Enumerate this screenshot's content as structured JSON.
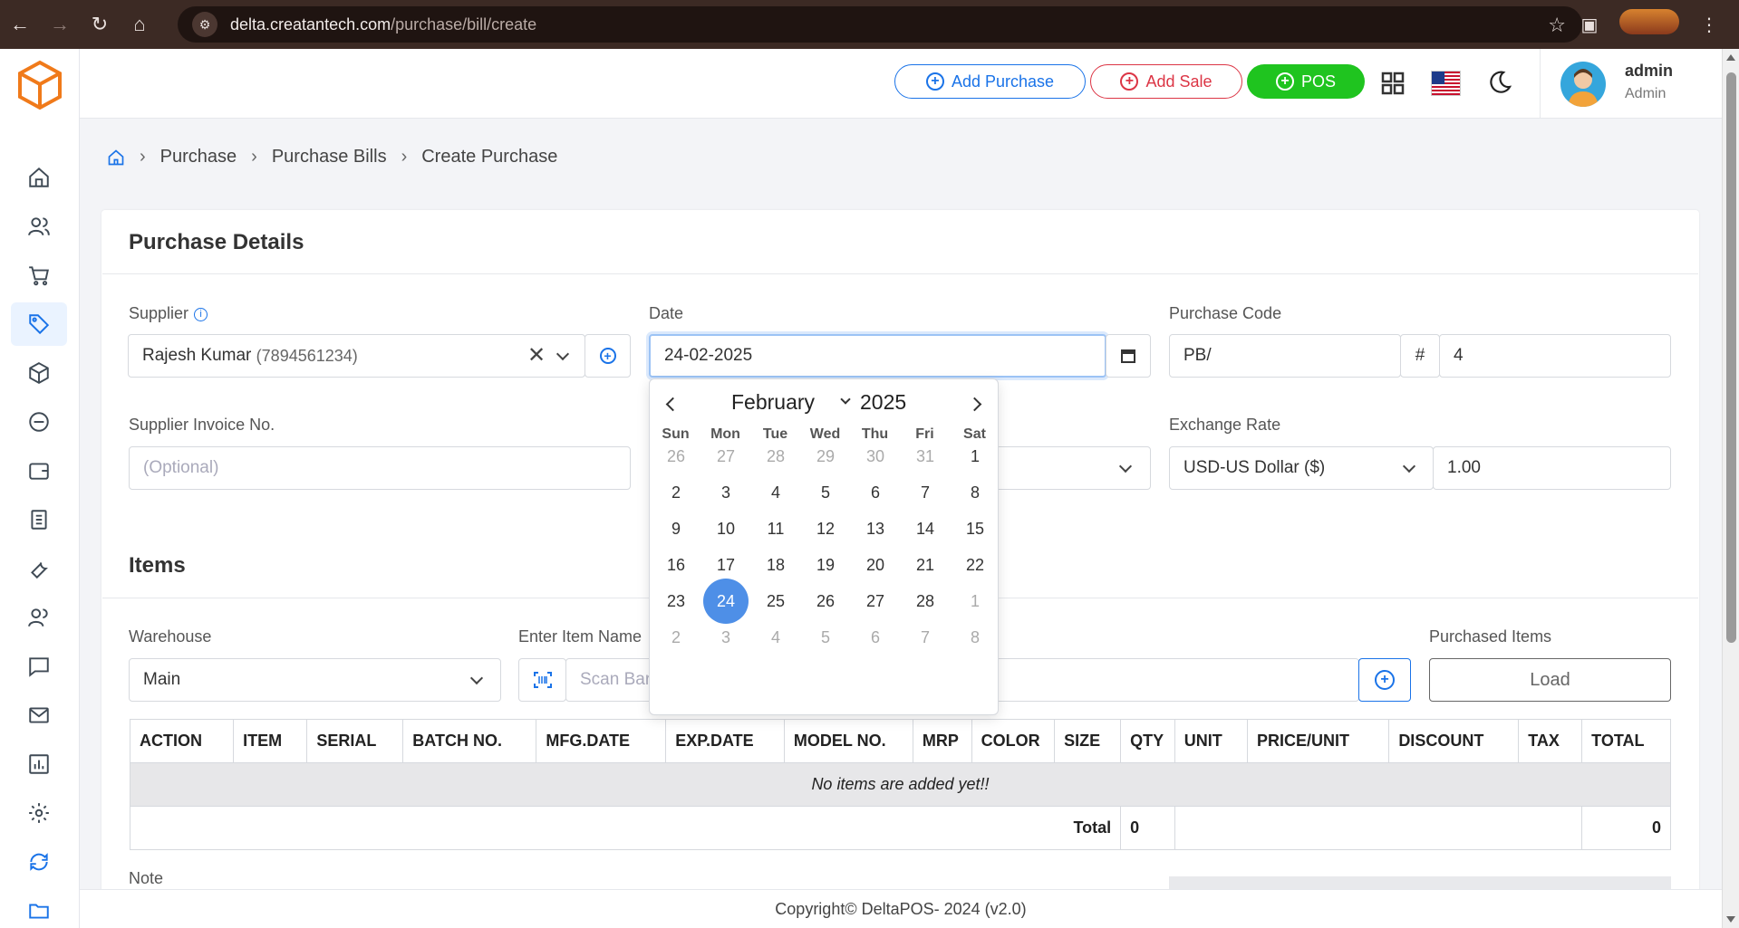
{
  "browser": {
    "url_host": "delta.creatantech.com",
    "url_path": "/purchase/bill/create"
  },
  "header": {
    "add_purchase_label": "Add Purchase",
    "add_sale_label": "Add Sale",
    "pos_label": "POS",
    "user_name": "admin",
    "user_role": "Admin"
  },
  "breadcrumb": [
    "Purchase",
    "Purchase Bills",
    "Create Purchase"
  ],
  "purchase_details": {
    "title": "Purchase Details",
    "supplier_label": "Supplier",
    "supplier_name": "Rajesh Kumar",
    "supplier_phone": "(7894561234)",
    "date_label": "Date",
    "date_value": "24-02-2025",
    "purchase_code_label": "Purchase Code",
    "purchase_code_prefix": "PB/",
    "purchase_code_hash": "#",
    "purchase_code_number": "4",
    "supplier_invoice_label": "Supplier Invoice No.",
    "supplier_invoice_placeholder": "(Optional)",
    "exchange_rate_label": "Exchange Rate",
    "currency_value": "USD-US Dollar ($)",
    "exchange_rate_value": "1.00"
  },
  "items": {
    "title": "Items",
    "warehouse_label": "Warehouse",
    "warehouse_value": "Main",
    "enter_item_label": "Enter Item Name",
    "scan_placeholder": "Scan Bar",
    "purchased_items_label": "Purchased Items",
    "load_label": "Load",
    "columns": [
      "ACTION",
      "ITEM",
      "SERIAL",
      "BATCH NO.",
      "MFG.DATE",
      "EXP.DATE",
      "MODEL NO.",
      "MRP",
      "COLOR",
      "SIZE",
      "QTY",
      "UNIT",
      "PRICE/UNIT",
      "DISCOUNT",
      "TAX",
      "TOTAL"
    ],
    "empty_message": "No items are added yet!!",
    "total_label": "Total",
    "total_qty": "0",
    "total_amount": "0",
    "note_label": "Note"
  },
  "calendar": {
    "month": "February",
    "year": "2025",
    "weekdays": [
      "Sun",
      "Mon",
      "Tue",
      "Wed",
      "Thu",
      "Fri",
      "Sat"
    ],
    "weeks": [
      [
        "26",
        "27",
        "28",
        "29",
        "30",
        "31",
        "1"
      ],
      [
        "2",
        "3",
        "4",
        "5",
        "6",
        "7",
        "8"
      ],
      [
        "9",
        "10",
        "11",
        "12",
        "13",
        "14",
        "15"
      ],
      [
        "16",
        "17",
        "18",
        "19",
        "20",
        "21",
        "22"
      ],
      [
        "23",
        "24",
        "25",
        "26",
        "27",
        "28",
        "1"
      ],
      [
        "2",
        "3",
        "4",
        "5",
        "6",
        "7",
        "8"
      ]
    ],
    "selected_day": "24"
  },
  "footer": {
    "copyright": "Copyright© DeltaPOS- 2024 (v2.0)"
  },
  "colors": {
    "primary": "#1a73e8",
    "danger": "#dc3545",
    "success": "#1fc41f",
    "selected_day": "#4e8fe7"
  }
}
